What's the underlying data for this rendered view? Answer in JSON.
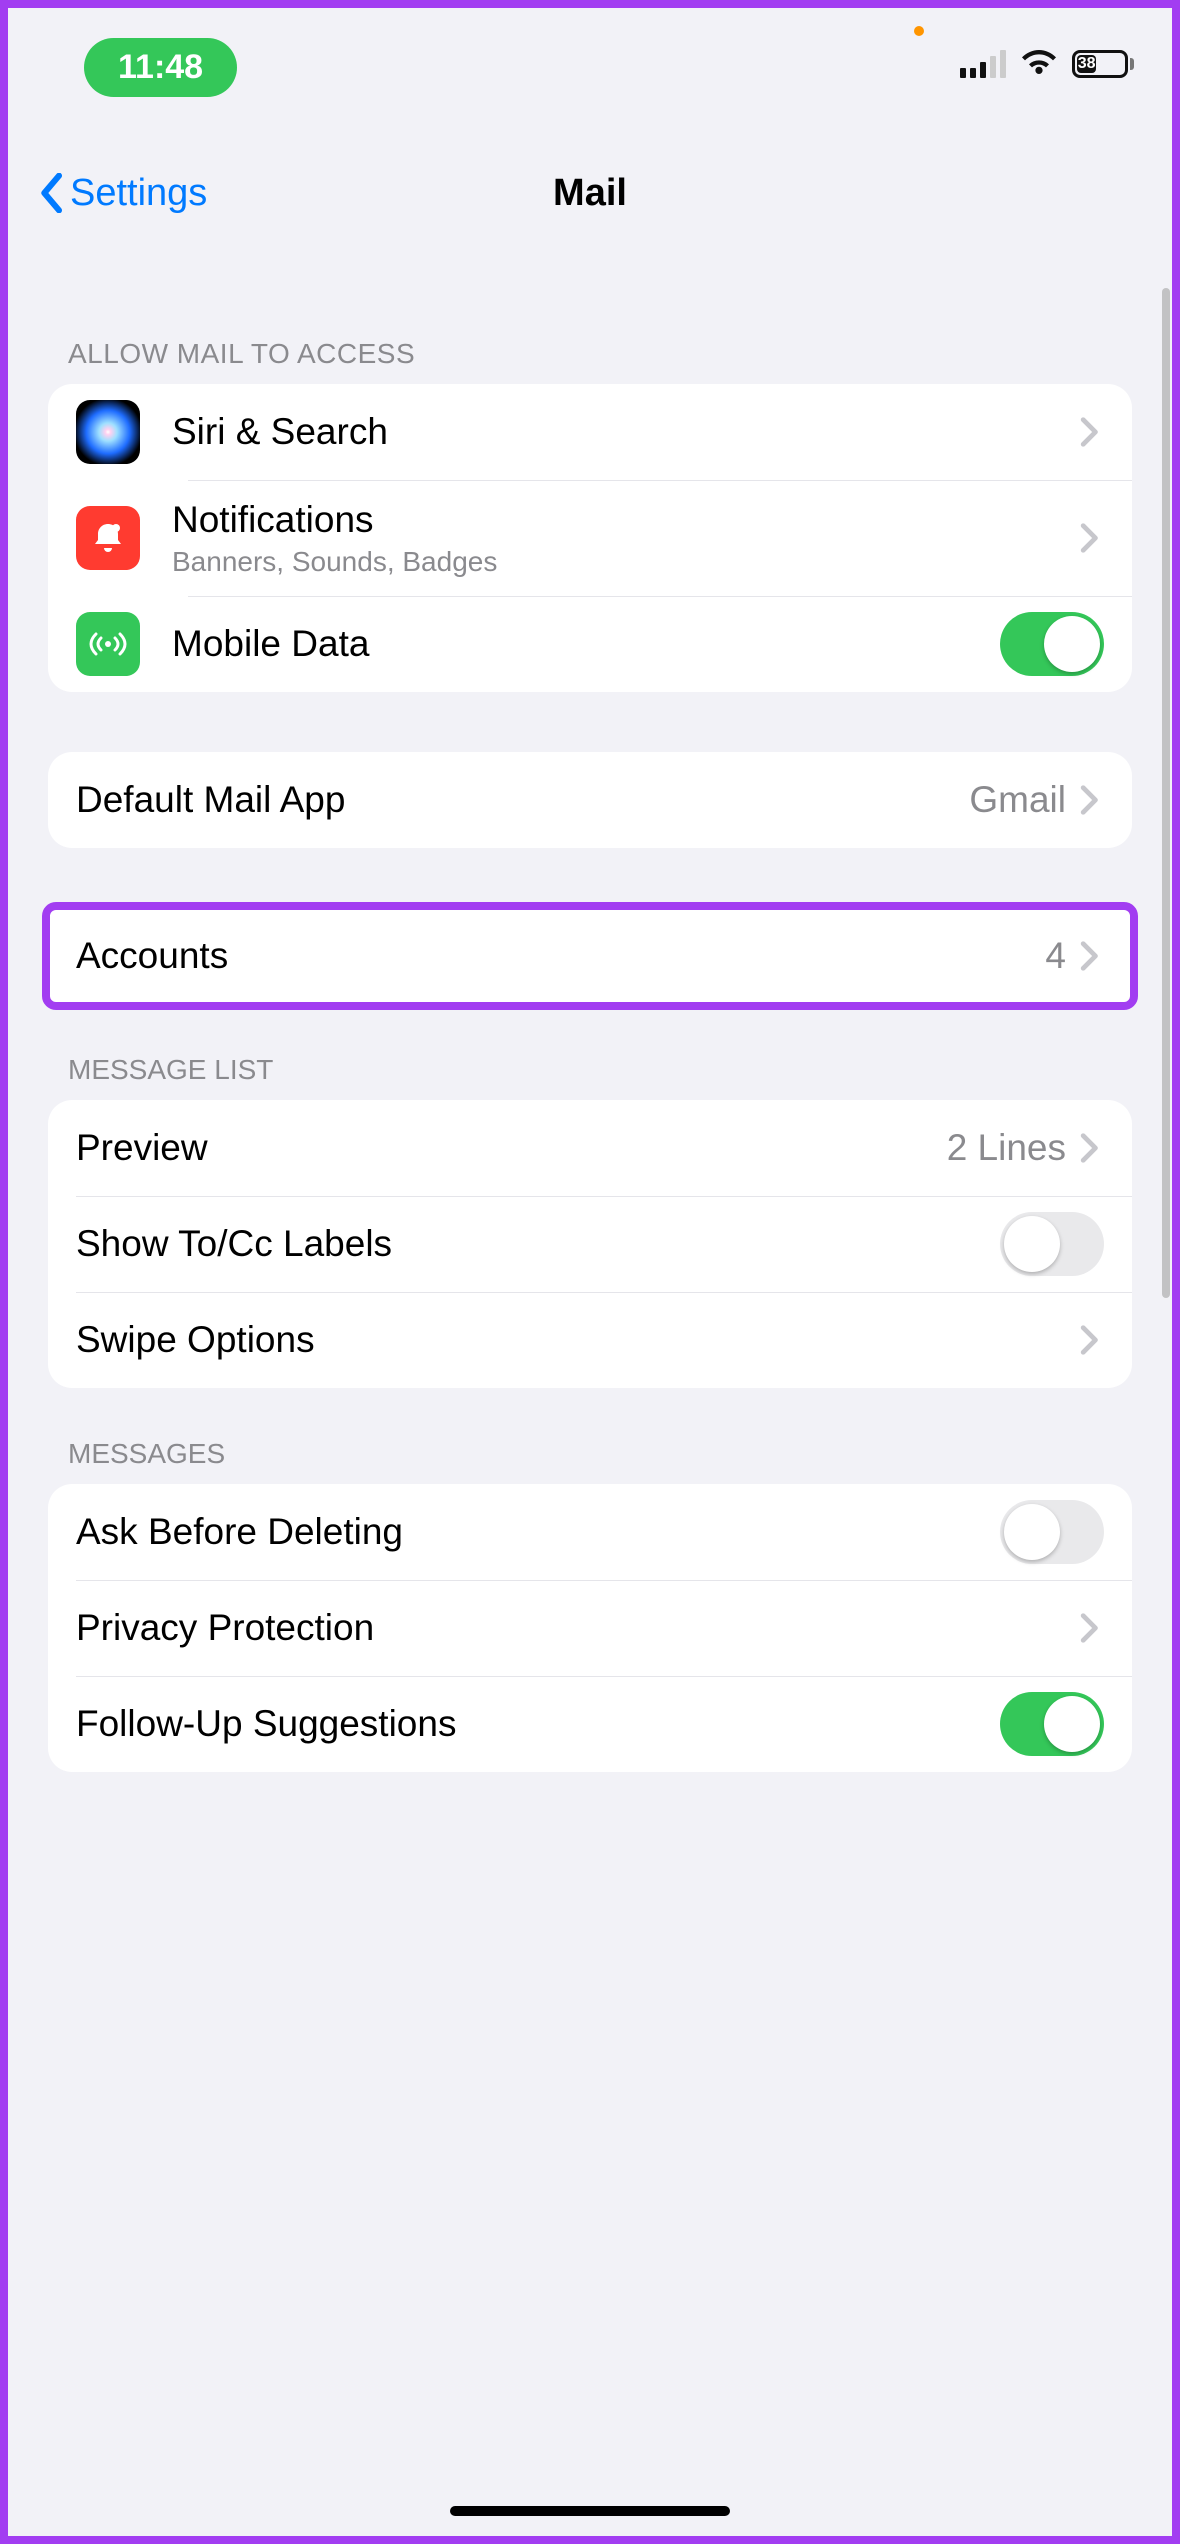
{
  "status": {
    "time": "11:48",
    "battery": "38"
  },
  "nav": {
    "back_label": "Settings",
    "title": "Mail"
  },
  "sections": {
    "allow": {
      "header": "ALLOW MAIL TO ACCESS",
      "siri": "Siri & Search",
      "notifications": "Notifications",
      "notifications_sub": "Banners, Sounds, Badges",
      "mobile_data": "Mobile Data"
    },
    "default_app": {
      "label": "Default Mail App",
      "value": "Gmail"
    },
    "accounts": {
      "label": "Accounts",
      "count": "4"
    },
    "message_list": {
      "header": "MESSAGE LIST",
      "preview": "Preview",
      "preview_value": "2 Lines",
      "show_tocc": "Show To/Cc Labels",
      "swipe": "Swipe Options"
    },
    "messages": {
      "header": "MESSAGES",
      "ask_before_deleting": "Ask Before Deleting",
      "privacy": "Privacy Protection",
      "followup": "Follow-Up Suggestions"
    }
  },
  "toggles": {
    "mobile_data": true,
    "show_tocc": false,
    "ask_before_deleting": false,
    "followup": true
  }
}
